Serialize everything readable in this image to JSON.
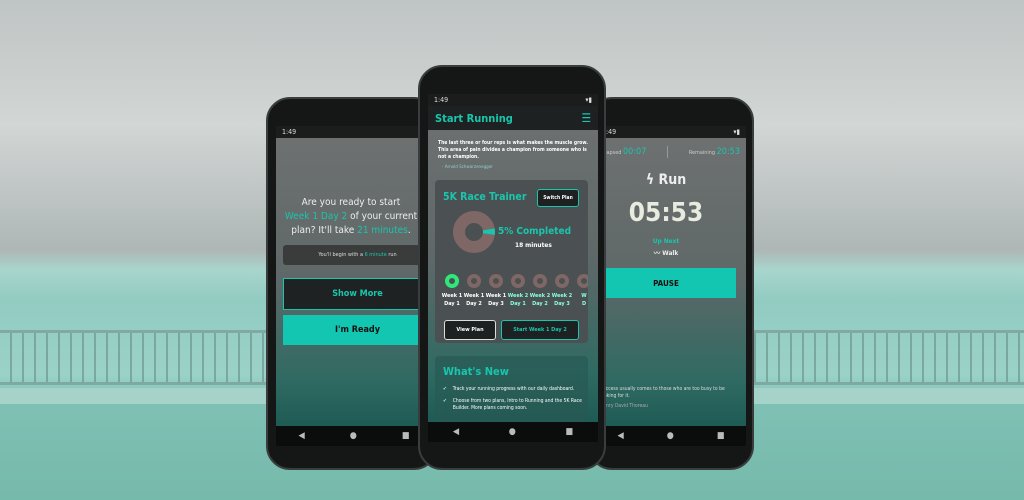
{
  "status_time": "1:49",
  "left_phone": {
    "prompt_1": "Are you ready to start",
    "prompt_plan": "Week 1 Day 2",
    "prompt_2": " of your current",
    "prompt_3": "plan? It'll take ",
    "prompt_minutes": "21 minutes",
    "prompt_end": ".",
    "begin_pre": "You'll begin with a ",
    "begin_value": "6 minute",
    "begin_post": " run",
    "show_more": "Show More",
    "ready": "I'm Ready"
  },
  "middle_phone": {
    "title": "Start Running",
    "quote": "The last three or four reps is what makes the muscle grow. This area of pain divides a champion from someone who is not a champion.",
    "quote_author": "- Arnold Schwarzenegger",
    "plan_name": "5K Race Trainer",
    "switch_plan": "Switch Plan",
    "progress_percent": 5,
    "completed_label": "5% Completed",
    "minutes": "18 minutes",
    "days": [
      {
        "week": "Week 1",
        "day": "Day 1",
        "state": "current"
      },
      {
        "week": "Week 1",
        "day": "Day 2",
        "state": "pending"
      },
      {
        "week": "Week 1",
        "day": "Day 3",
        "state": "pending"
      },
      {
        "week": "Week 2",
        "day": "Day 1",
        "state": "pending"
      },
      {
        "week": "Week 2",
        "day": "Day 2",
        "state": "pending"
      },
      {
        "week": "Week 2",
        "day": "Day 3",
        "state": "pending"
      },
      {
        "week": "W",
        "day": "D",
        "state": "pending"
      }
    ],
    "view_plan": "View Plan",
    "start_button": "Start Week 1 Day 2",
    "whats_new_title": "What's New",
    "whats_new": [
      "Track your running progress with our daily dashboard.",
      "Choose from two plans, Intro to Running and the 5K Race Builder. More plans coming soon."
    ]
  },
  "right_phone": {
    "elapsed_label": "Elapsed",
    "elapsed": "00:07",
    "remaining_label": "Remaining",
    "remaining": "20:53",
    "activity": "Run",
    "timer": "05:53",
    "up_next_label": "Up Next",
    "up_next": "Walk",
    "pause": "PAUSE",
    "quote": "Success usually comes to those who are too busy to be looking for it.",
    "quote_author": "Henry David Thoreau"
  },
  "colors": {
    "accent": "#19c6ad",
    "progress_track": "#7f6766",
    "current_day": "#2ee87a"
  }
}
